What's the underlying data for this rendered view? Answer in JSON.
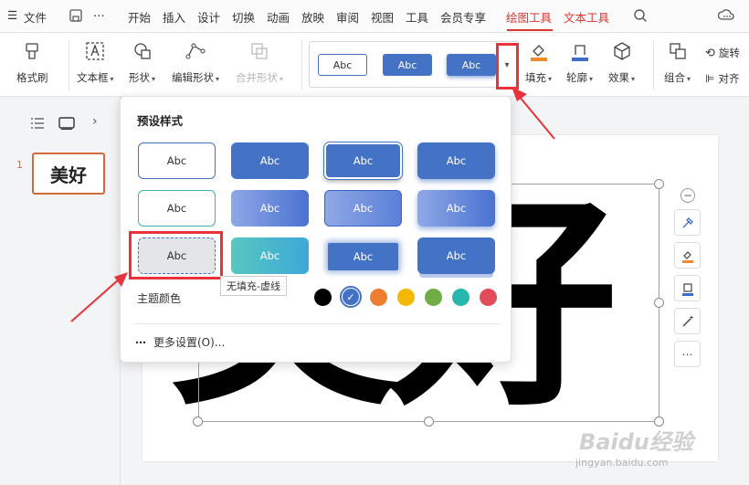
{
  "menubar": {
    "menu_label": "文件",
    "tabs": [
      "开始",
      "插入",
      "设计",
      "切换",
      "动画",
      "放映",
      "审阅",
      "视图",
      "工具",
      "会员专享",
      "绘图工具",
      "文本工具"
    ],
    "active_tab": "绘图工具",
    "more_glyph": "⋯"
  },
  "ribbon": {
    "format_painter": "格式刷",
    "text_box": "文本框",
    "shape": "形状",
    "edit_shape": "编辑形状",
    "merge_shape": "合并形状",
    "gallery_samples": [
      "Abc",
      "Abc",
      "Abc"
    ],
    "fill": "填充",
    "outline": "轮廓",
    "effect": "效果",
    "group": "组合",
    "rotate": "旋转",
    "align": "对齐",
    "accent_colors": {
      "fill": "#f08a2c",
      "outline": "#3d6cc9",
      "primary_blue": "#4472c4"
    }
  },
  "leftpane": {
    "slide_number": "1",
    "thumb_text": "美好"
  },
  "canvas": {
    "big_text": "美好"
  },
  "panel": {
    "title": "预设样式",
    "cell_label": "Abc",
    "theme_label": "主题颜色",
    "theme_colors": [
      "#000000",
      "#4472c4",
      "#ed7d31",
      "#f5b800",
      "#70ad47",
      "#26b7ae",
      "#e24b5c"
    ],
    "more_settings": "更多设置(O)...",
    "tooltip": "无填充-虚线"
  },
  "watermark": {
    "brand": "Baidu经验",
    "url": "jingyan.baidu.com"
  }
}
